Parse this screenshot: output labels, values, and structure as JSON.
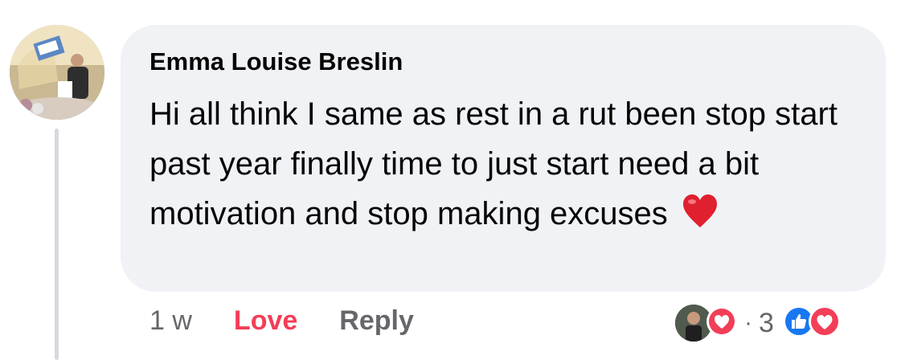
{
  "comment": {
    "author": "Emma Louise Breslin",
    "text": "Hi all think I same as rest in a rut been stop start past year finally time to just start need a bit motivation and stop making excuses",
    "emoji": "heart-emoji"
  },
  "actions": {
    "time": "1 w",
    "love_label": "Love",
    "reply_label": "Reply"
  },
  "reactions": {
    "separator": "·",
    "count": "3",
    "types": [
      "like-icon",
      "love-icon"
    ]
  },
  "colors": {
    "bubble": "#f0f2f5",
    "love": "#f33e58",
    "like": "#1877f2",
    "muted": "#65676b"
  }
}
